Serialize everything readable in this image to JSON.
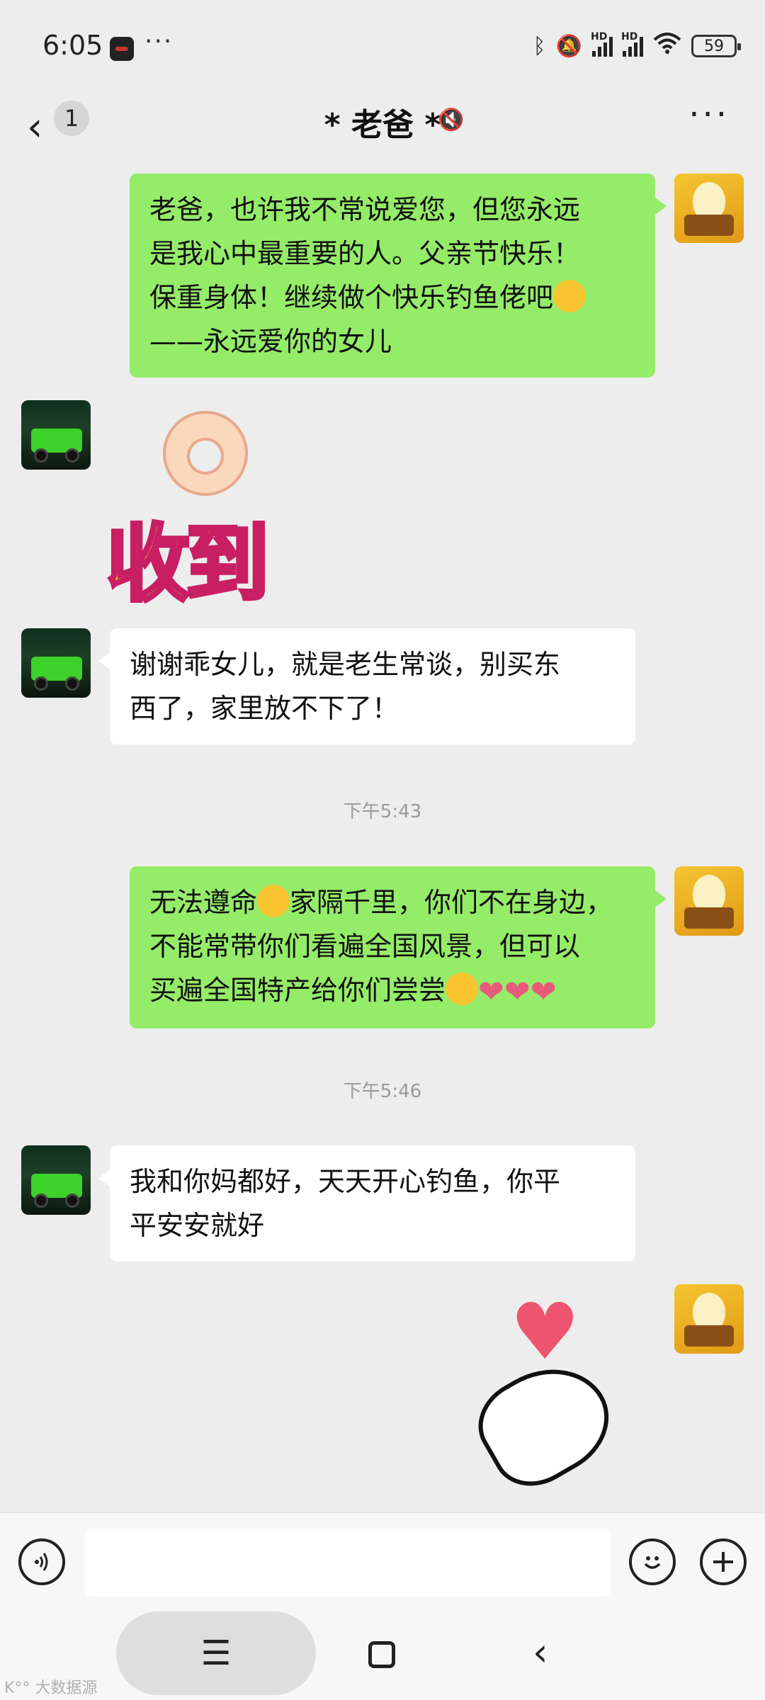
{
  "status": {
    "time": "6:05",
    "dots": "···",
    "battery": "59",
    "hd1": "HD",
    "hd2": "HD"
  },
  "header": {
    "back_count": "1",
    "title": "* 老爸 *",
    "more": "···"
  },
  "messages": [
    {
      "from": "me",
      "text_lines": [
        "老爸，也许我不常说爱您，但您永远",
        "是我心中最重要的人。父亲节快乐！",
        "保重身体！继续做个快乐钓鱼佬吧",
        "——永远爱你的女儿"
      ]
    },
    {
      "from": "dad",
      "sticker_text": "收到"
    },
    {
      "from": "dad",
      "text_lines": [
        "谢谢乖女儿，就是老生常谈，别买东",
        "西了，家里放不下了！"
      ]
    },
    {
      "time": "下午5:43"
    },
    {
      "from": "me",
      "text_lines": [
        "无法遵命",
        "家隔千里，你们不在身边，",
        "不能常带你们看遍全国风景，但可以",
        "买遍全国特产给你们尝尝"
      ]
    },
    {
      "time": "下午5:46"
    },
    {
      "from": "dad",
      "text_lines": [
        "我和你妈都好，天天开心钓鱼，你平",
        "平安安就好"
      ]
    },
    {
      "from": "me",
      "sticker": "heart-hand"
    }
  ],
  "input": {
    "placeholder": ""
  },
  "nav": {
    "menu_icon": "☰",
    "back_icon": "‹"
  },
  "watermark": "K°° 大数据源"
}
